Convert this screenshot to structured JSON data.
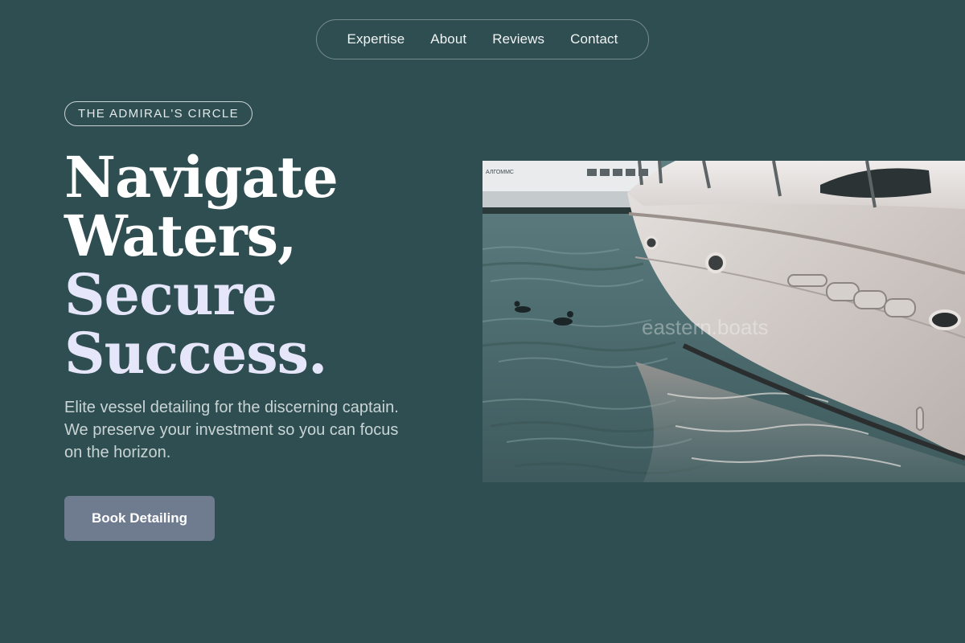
{
  "nav": {
    "items": [
      "Expertise",
      "About",
      "Reviews",
      "Contact"
    ]
  },
  "badge": "THE ADMIRAL'S CIRCLE",
  "headline": {
    "line1": "Navigate",
    "line2": "Waters,",
    "line3": "Secure",
    "line4": "Success."
  },
  "subtext": "Elite vessel detailing for the discerning captain. We preserve your investment so you can focus on the horizon.",
  "cta": "Book Detailing",
  "hero_image": {
    "alt": "White yacht hull moored in harbor water with ducks",
    "watermark": "eastern.boats",
    "distant_boat_name": "АЛГОММС"
  },
  "colors": {
    "background": "#2f4e51",
    "accent_lavender": "#e6e6fa",
    "button": "#6f7b8f"
  }
}
